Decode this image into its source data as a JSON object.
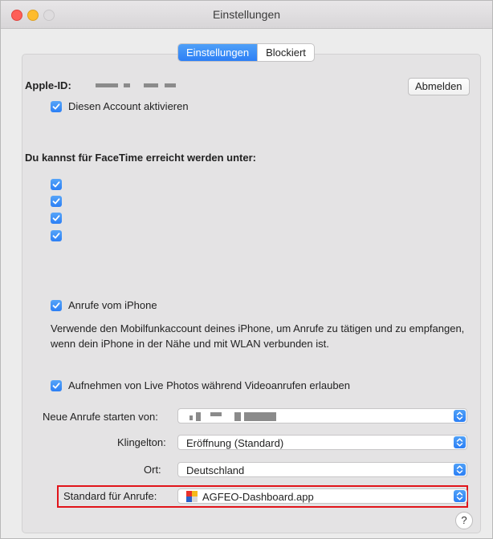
{
  "window": {
    "title": "Einstellungen"
  },
  "tabs": [
    {
      "label": "Einstellungen",
      "active": true
    },
    {
      "label": "Blockiert",
      "active": false
    }
  ],
  "account": {
    "apple_id_label": "Apple-ID:",
    "signout_button": "Abmelden",
    "enable_account_label": "Diesen Account aktivieren",
    "enable_account_checked": true
  },
  "reachable": {
    "heading": "Du kannst für FaceTime erreicht werden unter:",
    "items": [
      {
        "checked": true
      },
      {
        "checked": true
      },
      {
        "checked": true
      },
      {
        "checked": true
      }
    ]
  },
  "iphone_calls": {
    "label": "Anrufe vom iPhone",
    "checked": true,
    "description": "Verwende den Mobilfunkaccount deines iPhone, um Anrufe zu tätigen und zu empfangen, wenn dein iPhone in der Nähe und mit WLAN verbunden ist."
  },
  "live_photos": {
    "label": "Aufnehmen von Live Photos während Videoanrufen erlauben",
    "checked": true
  },
  "settings": {
    "start_calls": {
      "label": "Neue Anrufe starten von:"
    },
    "ringtone": {
      "label": "Klingelton:",
      "value": "Eröffnung (Standard)"
    },
    "location": {
      "label": "Ort:",
      "value": "Deutschland"
    },
    "default_calls": {
      "label": "Standard für Anrufe:",
      "value": "AGFEO-Dashboard.app"
    }
  },
  "help_button": "?",
  "colors": {
    "accent": "#2d7ff6",
    "highlight_border": "#e1141a"
  }
}
